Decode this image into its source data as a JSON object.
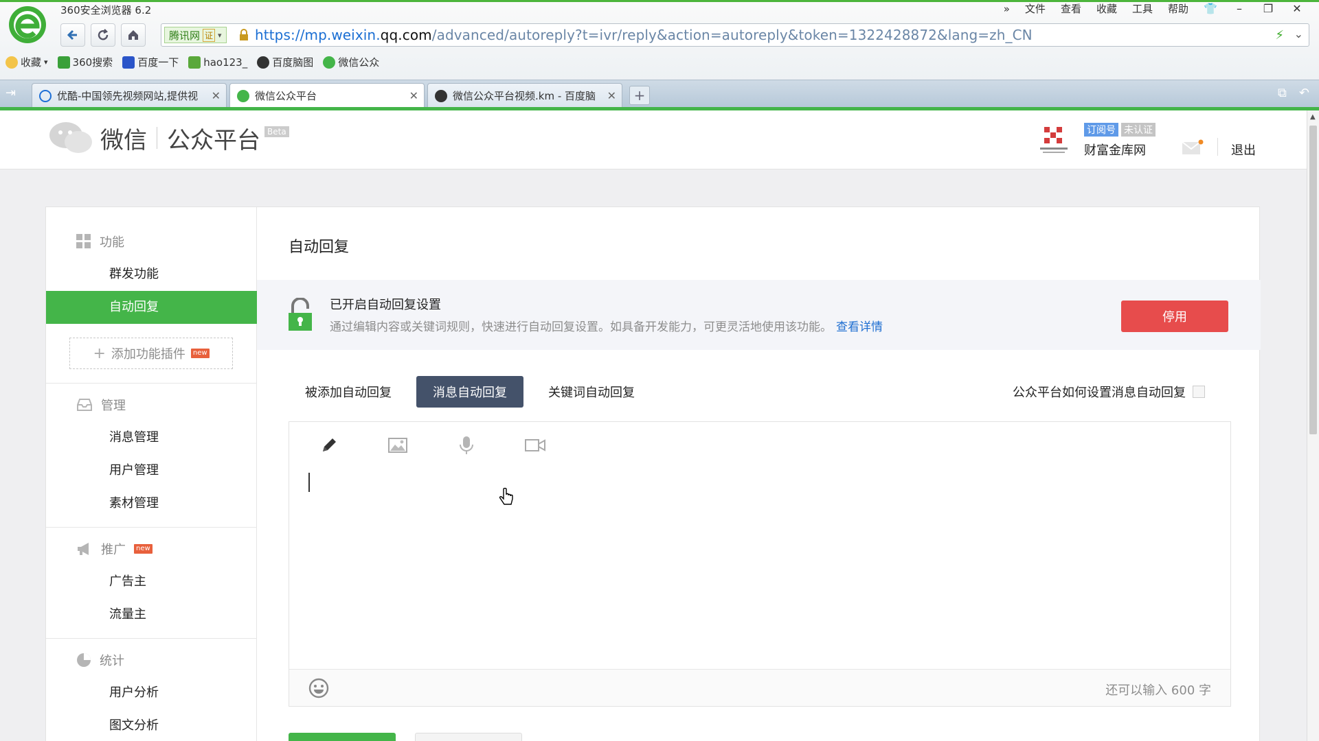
{
  "browser": {
    "title": "360安全浏览器 6.2",
    "menu": [
      "文件",
      "查看",
      "收藏",
      "工具",
      "帮助"
    ],
    "site_badge": "腾讯网",
    "cert_badge": "证",
    "url_scheme_host": "https://mp.weixin.",
    "url_domain": "qq.com",
    "url_path": "/advanced/autoreply?t=ivr/reply&action=autoreply&token=1322428872&lang=zh_CN",
    "bookmarks": [
      "收藏",
      "360搜索",
      "百度一下",
      "hao123_",
      "百度脑图",
      "微信公众"
    ],
    "tabs": [
      {
        "label": "优酷-中国领先视频网站,提供视"
      },
      {
        "label": "微信公众平台"
      },
      {
        "label": "微信公众平台视频.km - 百度脑"
      }
    ],
    "new_tab_symbol": "+"
  },
  "header": {
    "logo_text": "微信",
    "platform_text": "公众平台",
    "beta": "Beta",
    "account_type": "订阅号",
    "account_status": "未认证",
    "account_name": "财富金库网",
    "logout": "退出"
  },
  "sidebar": {
    "sections": [
      {
        "title": "功能",
        "icon": "grid-icon",
        "items": [
          "群发功能",
          "自动回复"
        ]
      },
      {
        "title": "管理",
        "icon": "inbox-icon",
        "items": [
          "消息管理",
          "用户管理",
          "素材管理"
        ]
      },
      {
        "title": "推广",
        "icon": "megaphone-icon",
        "items": [
          "广告主",
          "流量主"
        ]
      },
      {
        "title": "统计",
        "icon": "pie-chart-icon",
        "items": [
          "用户分析",
          "图文分析"
        ]
      }
    ],
    "add_plugin": "添加功能插件",
    "new_label": "new",
    "active_item": "自动回复"
  },
  "content": {
    "title": "自动回复",
    "notice_title": "已开启自动回复设置",
    "notice_desc": "通过编辑内容或关键词规则，快速进行自动回复设置。如具备开发能力，可更灵活地使用该功能。",
    "notice_link": "查看详情",
    "stop_button": "停用",
    "tabs": [
      "被添加自动回复",
      "消息自动回复",
      "关键词自动回复"
    ],
    "active_tab": "消息自动回复",
    "help_link": "公众平台如何设置消息自动回复",
    "char_count": "还可以输入 600 字"
  },
  "colors": {
    "brand_green": "#44b549",
    "stop_red": "#e74c4c",
    "active_tab": "#44526a",
    "link_blue": "#1f6fd1"
  }
}
